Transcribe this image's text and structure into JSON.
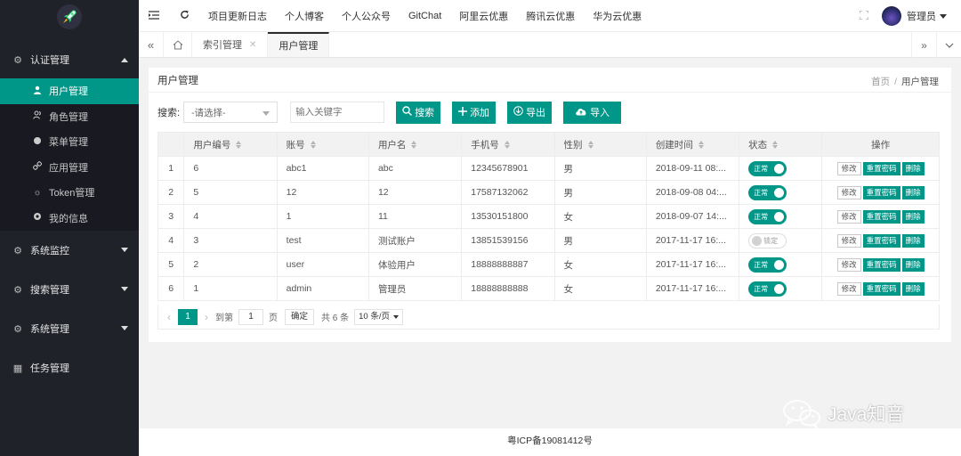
{
  "sidebar": {
    "logo_icon": "rocket-icon",
    "groups": [
      {
        "label": "认证管理",
        "icon": "gear-icon",
        "expanded": true,
        "items": [
          {
            "label": "用户管理",
            "icon": "user-icon",
            "active": true
          },
          {
            "label": "角色管理",
            "icon": "users-icon"
          },
          {
            "label": "菜单管理",
            "icon": "circle-icon"
          },
          {
            "label": "应用管理",
            "icon": "link-icon"
          },
          {
            "label": "Token管理",
            "icon": "cog-icon"
          },
          {
            "label": "我的信息",
            "icon": "info-circle-icon"
          }
        ]
      },
      {
        "label": "系统监控",
        "icon": "gear-icon",
        "expanded": false
      },
      {
        "label": "搜索管理",
        "icon": "gear-icon",
        "expanded": false
      },
      {
        "label": "系统管理",
        "icon": "gear-icon",
        "expanded": false
      },
      {
        "label": "任务管理",
        "icon": "grid-icon"
      }
    ]
  },
  "topbar": {
    "links": [
      "项目更新日志",
      "个人博客",
      "个人公众号",
      "GitChat",
      "阿里云优惠",
      "腾讯云优惠",
      "华为云优惠"
    ],
    "user": "管理员"
  },
  "tabs": [
    {
      "label": "索引管理",
      "active": false
    },
    {
      "label": "用户管理",
      "active": true
    }
  ],
  "page": {
    "title": "用户管理",
    "breadcrumb": [
      "首页",
      "用户管理"
    ]
  },
  "search": {
    "label": "搜索:",
    "select_value": "-请选择-",
    "input_placeholder": "输入关键字",
    "buttons": {
      "search": "搜索",
      "add": "添加",
      "export": "导出",
      "import": "导入"
    }
  },
  "table": {
    "columns": [
      "用户编号",
      "账号",
      "用户名",
      "手机号",
      "性别",
      "创建时间",
      "状态",
      "操作"
    ],
    "rows": [
      {
        "index": "1",
        "id": "6",
        "account": "abc1",
        "name": "abc",
        "phone": "12345678901",
        "gender": "男",
        "created": "2018-09-11 08:...",
        "status": "正常",
        "active": true
      },
      {
        "index": "2",
        "id": "5",
        "account": "12",
        "name": "12",
        "phone": "17587132062",
        "gender": "男",
        "created": "2018-09-08 04:...",
        "status": "正常",
        "active": true
      },
      {
        "index": "3",
        "id": "4",
        "account": "1",
        "name": "11",
        "phone": "13530151800",
        "gender": "女",
        "created": "2018-09-07 14:...",
        "status": "正常",
        "active": true
      },
      {
        "index": "4",
        "id": "3",
        "account": "test",
        "name": "测试账户",
        "phone": "13851539156",
        "gender": "男",
        "created": "2017-11-17 16:...",
        "status": "锁定",
        "active": false
      },
      {
        "index": "5",
        "id": "2",
        "account": "user",
        "name": "体验用户",
        "phone": "18888888887",
        "gender": "女",
        "created": "2017-11-17 16:...",
        "status": "正常",
        "active": true
      },
      {
        "index": "6",
        "id": "1",
        "account": "admin",
        "name": "管理员",
        "phone": "18888888888",
        "gender": "女",
        "created": "2017-11-17 16:...",
        "status": "正常",
        "active": true
      }
    ],
    "actions": {
      "edit": "修改",
      "reset": "重置密码",
      "delete": "删除"
    }
  },
  "pagination": {
    "current": "1",
    "goto_label": "到第",
    "goto_value": "1",
    "page_label": "页",
    "confirm": "确定",
    "total": "共 6 条",
    "page_size": "10 条/页"
  },
  "footer": {
    "text": "粤ICP备19081412号"
  },
  "watermark": {
    "text": "Java知音",
    "icon": "wechat-icon"
  },
  "colors": {
    "accent": "#009688",
    "sidebar": "#20222a"
  }
}
